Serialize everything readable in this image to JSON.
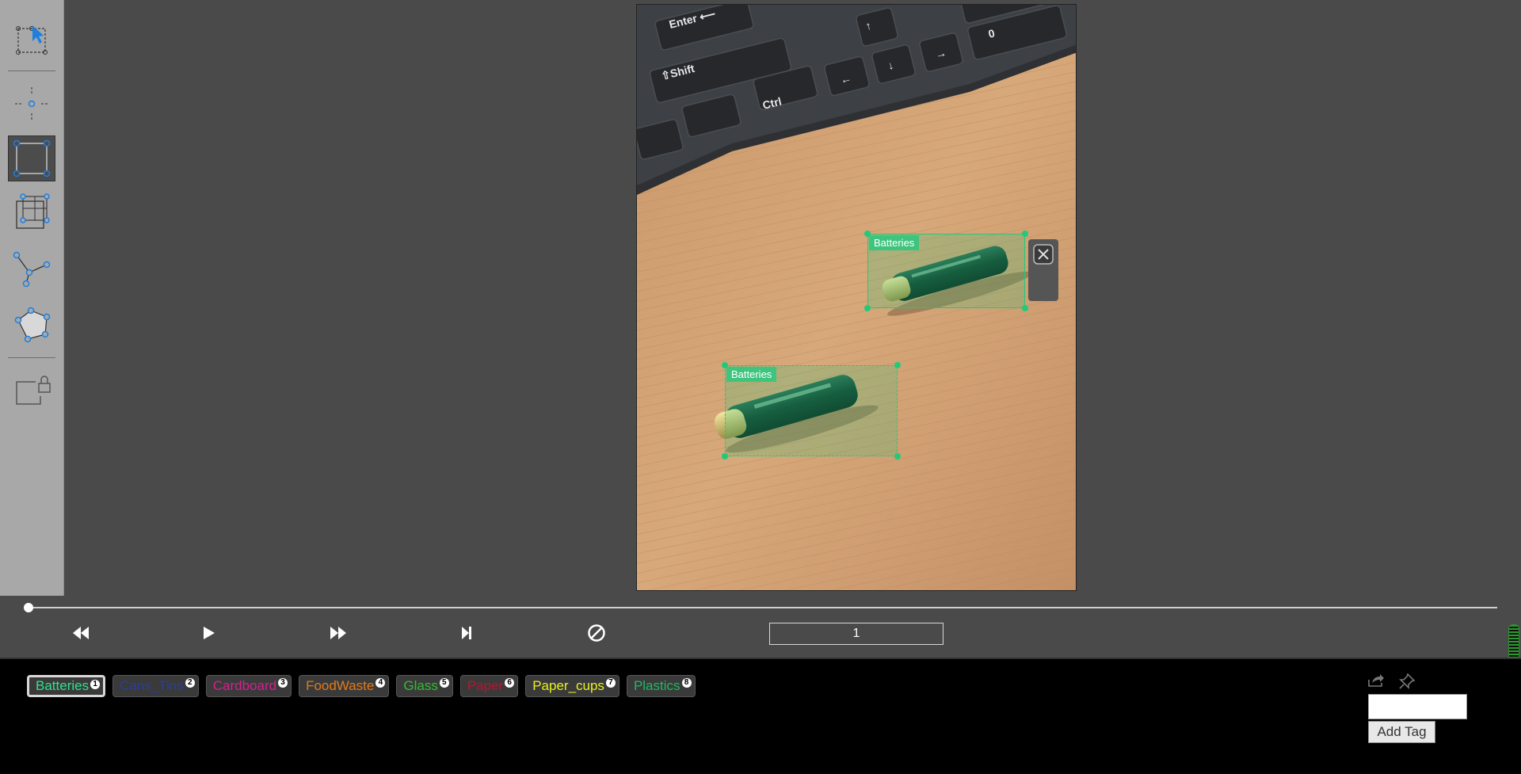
{
  "toolbar": {
    "tools": [
      "select-tool",
      "point-tool",
      "rectangle-tool",
      "copy-rectangle-tool",
      "polyline-tool",
      "polygon-tool",
      "lock-tool"
    ],
    "active": "rectangle-tool"
  },
  "annotations": [
    {
      "label": "Batteries",
      "color": "#22c97a",
      "state": "selected"
    },
    {
      "label": "Batteries",
      "color": "#22c97a",
      "state": "dashed"
    }
  ],
  "playback": {
    "frame_value": "1",
    "buttons": [
      "previous-frame",
      "play",
      "next-frame",
      "skip-to-end",
      "clear"
    ]
  },
  "tags": [
    {
      "name": "Batteries",
      "hotkey": "1",
      "color": "#2ee38e",
      "selected": true
    },
    {
      "name": "Cans_Tins",
      "hotkey": "2",
      "color": "#2a3f9c",
      "selected": false
    },
    {
      "name": "Cardboard",
      "hotkey": "3",
      "color": "#d61f8f",
      "selected": false
    },
    {
      "name": "FoodWaste",
      "hotkey": "4",
      "color": "#e07a17",
      "selected": false
    },
    {
      "name": "Glass",
      "hotkey": "5",
      "color": "#2fbf2f",
      "selected": false
    },
    {
      "name": "Paper",
      "hotkey": "6",
      "color": "#b8142f",
      "selected": false
    },
    {
      "name": "Paper_cups",
      "hotkey": "7",
      "color": "#e6f01e",
      "selected": false
    },
    {
      "name": "Plastics",
      "hotkey": "8",
      "color": "#1fb85f",
      "selected": false
    }
  ],
  "tag_panel": {
    "add_tag_label": "Add Tag",
    "input_placeholder": ""
  }
}
